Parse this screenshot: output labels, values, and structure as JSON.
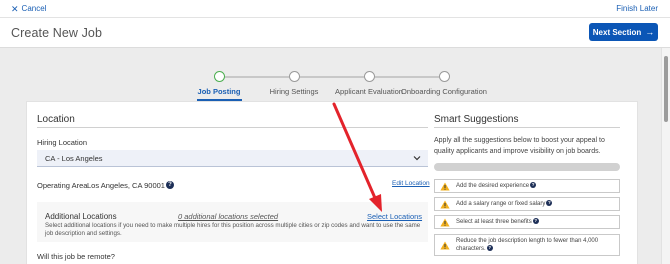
{
  "topbar": {
    "cancel_label": "Cancel",
    "finish_label": "Finish Later"
  },
  "header": {
    "title": "Create New Job",
    "next_label": "Next Section"
  },
  "stepper": {
    "steps": [
      {
        "label": "Job Posting",
        "active": true
      },
      {
        "label": "Hiring Settings",
        "active": false
      },
      {
        "label": "Applicant Evaluation",
        "active": false
      },
      {
        "label": "Onboarding Configuration",
        "active": false
      }
    ]
  },
  "location": {
    "section_title": "Location",
    "hiring_location_label": "Hiring Location",
    "hiring_location_value": "CA - Los Angeles",
    "operating_area_label": "Operating Area",
    "operating_area_value": "Los Angeles, CA 90001",
    "edit_location": "Edit Location",
    "additional_title": "Additional Locations",
    "additional_count": "0 additional locations selected",
    "select_locations": "Select Locations",
    "additional_desc_1": "Select additional locations if you need to make multiple hires for this position across multiple cities or zip codes and want to use the same",
    "additional_desc_2": "job description and settings.",
    "remote_question": "Will this job be remote?"
  },
  "smart": {
    "title": "Smart Suggestions",
    "intro": "Apply all the suggestions below to boost your appeal to quality applicants and improve visibility on job boards.",
    "progress": 0.0,
    "items": [
      "Add the desired experience",
      "Add a salary range or fixed salary",
      "Select at least three benefits",
      "Reduce the job description length to fewer than 4,000 characters."
    ]
  },
  "colors": {
    "primary": "#0b56b6",
    "link": "#1a5fb4",
    "step_active": "#4caf50",
    "annotation_arrow": "#e3232b",
    "warning": "#f2b01e"
  },
  "icons": {
    "cancel": "close-icon",
    "next": "arrow-right-icon",
    "help": "question-icon",
    "warning": "warning-icon",
    "dropdown": "chevron-down-icon"
  }
}
